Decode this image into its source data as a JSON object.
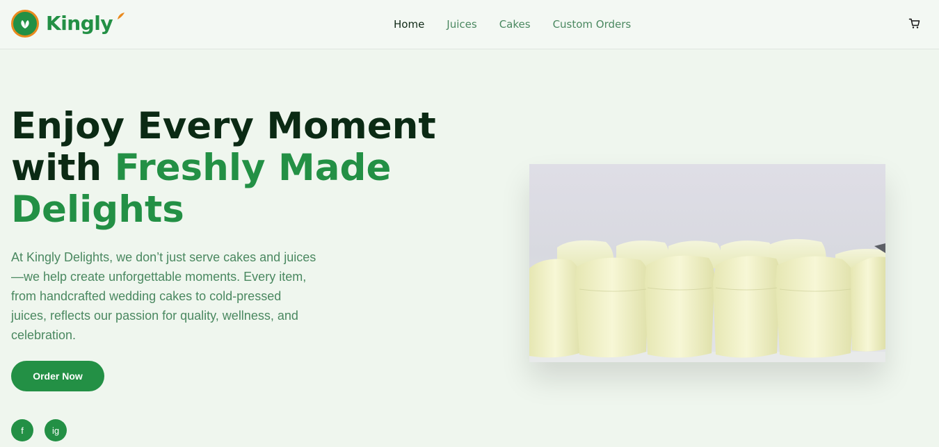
{
  "brand": {
    "name": "Kingly"
  },
  "nav": {
    "links": [
      {
        "label": "Home",
        "active": true
      },
      {
        "label": "Juices",
        "active": false
      },
      {
        "label": "Cakes",
        "active": false
      },
      {
        "label": "Custom Orders",
        "active": false
      }
    ],
    "cart_icon": "cart-icon"
  },
  "hero": {
    "title_line1": "Enjoy Every Moment",
    "title_with": "with",
    "title_accent": "Freshly Made",
    "title_line3": "Delights",
    "description": "At Kingly Delights, we don’t just serve cakes and juices—we help create unforgettable moments. Every item, from handcrafted wedding cakes to cold-pressed juices, reflects our passion for quality, wellness, and celebration.",
    "cta_label": "Order Now",
    "image_icon": "juice-containers-photo"
  },
  "social": [
    {
      "label": "f",
      "icon": "facebook-icon"
    },
    {
      "label": "ig",
      "icon": "instagram-icon"
    }
  ],
  "colors": {
    "brand_green": "#239045",
    "dark_green": "#0b2a14",
    "muted_green": "#4a8860",
    "logo_orange": "#e98a1e",
    "page_bg": "#eff6ee"
  }
}
